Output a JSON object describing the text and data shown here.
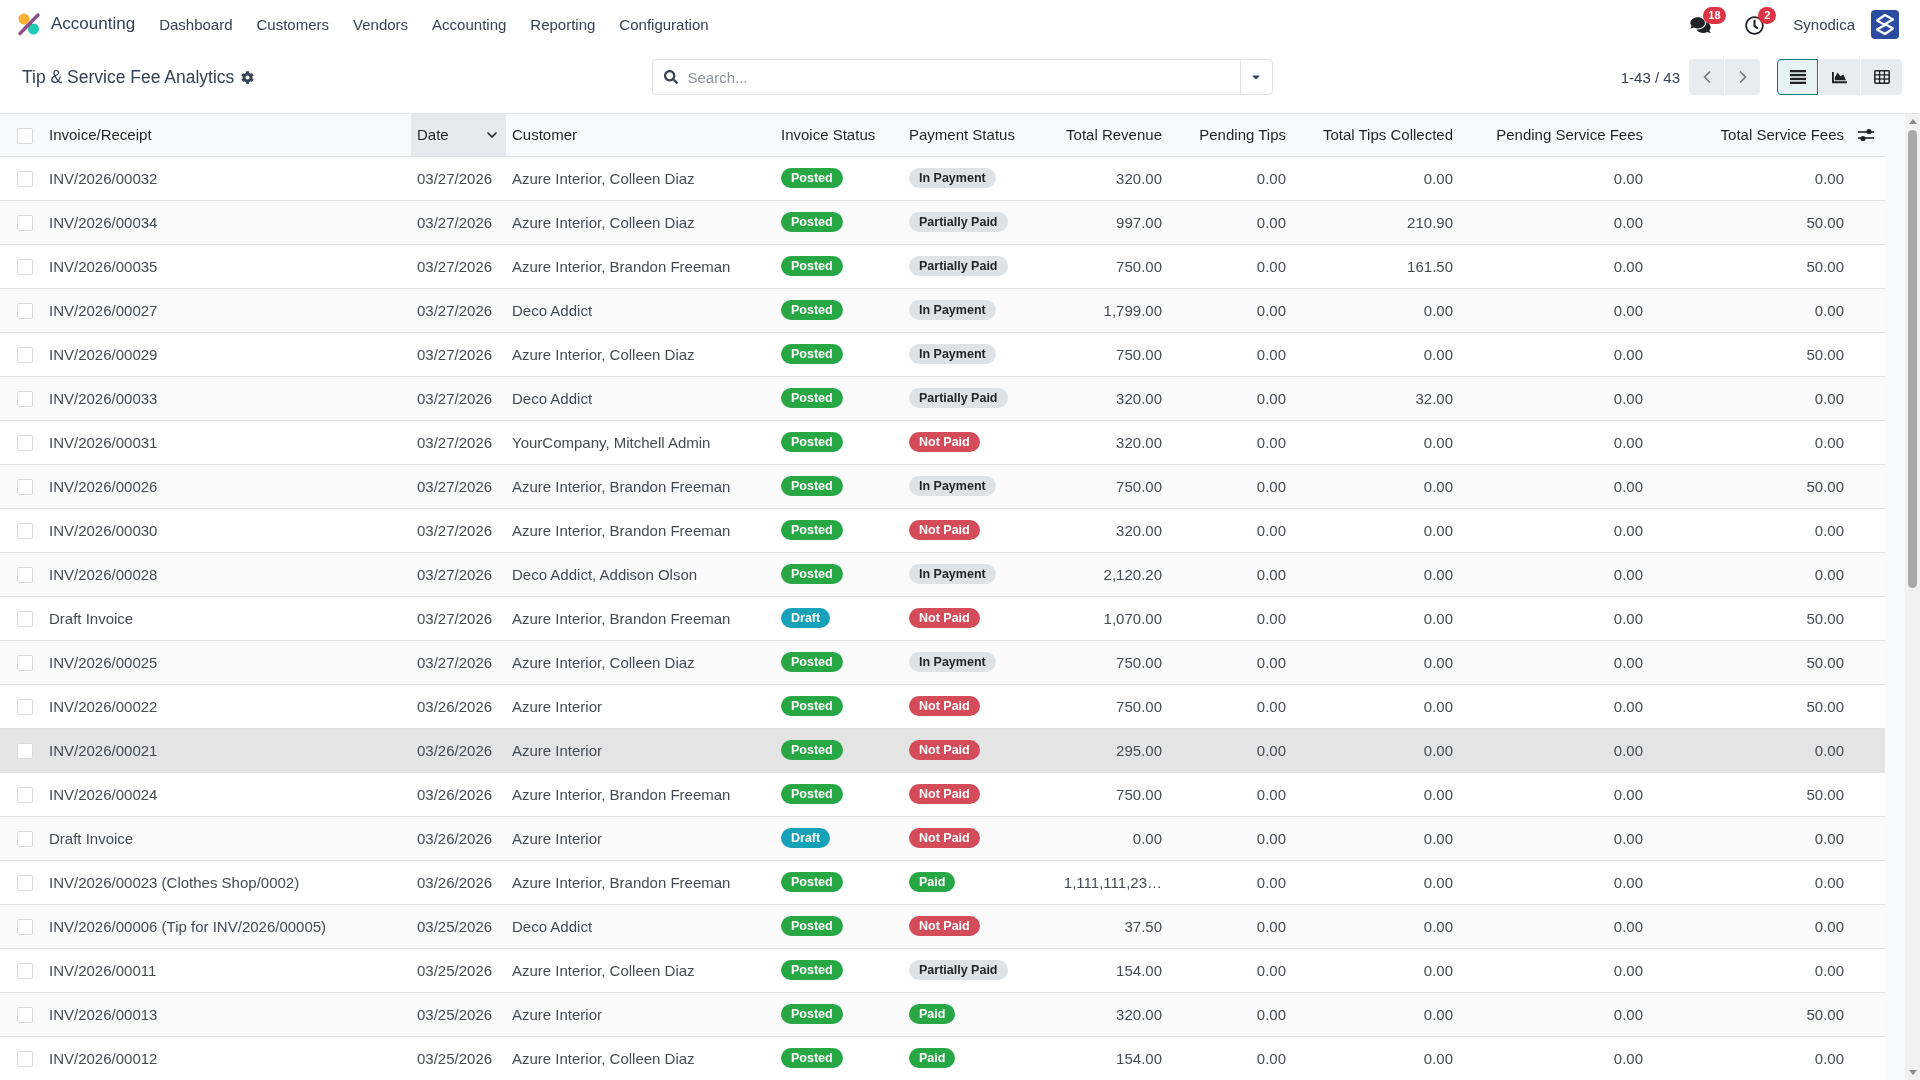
{
  "navbar": {
    "app_name": "Accounting",
    "menu": [
      "Dashboard",
      "Customers",
      "Vendors",
      "Accounting",
      "Reporting",
      "Configuration"
    ],
    "systray": [
      {
        "kind": "messages",
        "count": "18"
      },
      {
        "kind": "activities",
        "count": "2"
      }
    ],
    "company": "Synodica"
  },
  "control_panel": {
    "title": "Tip & Service Fee Analytics",
    "search": {
      "placeholder": "Search..."
    },
    "pager": "1-43 / 43",
    "views": [
      {
        "kind": "list",
        "selected": true
      },
      {
        "kind": "graph",
        "selected": false
      },
      {
        "kind": "pivot",
        "selected": false
      }
    ]
  },
  "table": {
    "all_checked": false,
    "columns": [
      {
        "label": "Invoice/Receipt",
        "kind": "text",
        "sorted": false
      },
      {
        "label": "Date",
        "kind": "text",
        "sorted": true
      },
      {
        "label": "Customer",
        "kind": "text",
        "sorted": false
      },
      {
        "label": "Invoice Status",
        "kind": "badge",
        "sorted": false
      },
      {
        "label": "Payment Status",
        "kind": "badge",
        "sorted": false
      },
      {
        "label": "Total Revenue",
        "kind": "number",
        "sorted": false
      },
      {
        "label": "Pending Tips",
        "kind": "number",
        "sorted": false
      },
      {
        "label": "Total Tips Collected",
        "kind": "number",
        "sorted": false
      },
      {
        "label": "Pending Service Fees",
        "kind": "number",
        "sorted": false
      },
      {
        "label": "Total Service Fees",
        "kind": "number",
        "sorted": false
      }
    ],
    "rows": [
      {
        "checked": false,
        "highlighted": false,
        "cells": [
          "INV/2026/00032",
          "03/27/2026",
          "Azure Interior, Colleen Diaz",
          {
            "label": "Posted",
            "color": "#28a745"
          },
          {
            "label": "In Payment",
            "color": "#dee2e6"
          },
          "320.00",
          "0.00",
          "0.00",
          "0.00",
          "0.00"
        ]
      },
      {
        "checked": false,
        "highlighted": false,
        "cells": [
          "INV/2026/00034",
          "03/27/2026",
          "Azure Interior, Colleen Diaz",
          {
            "label": "Posted",
            "color": "#28a745"
          },
          {
            "label": "Partially Paid",
            "color": "#dee2e6"
          },
          "997.00",
          "0.00",
          "210.90",
          "0.00",
          "50.00"
        ]
      },
      {
        "checked": false,
        "highlighted": false,
        "cells": [
          "INV/2026/00035",
          "03/27/2026",
          "Azure Interior, Brandon Freeman",
          {
            "label": "Posted",
            "color": "#28a745"
          },
          {
            "label": "Partially Paid",
            "color": "#dee2e6"
          },
          "750.00",
          "0.00",
          "161.50",
          "0.00",
          "50.00"
        ]
      },
      {
        "checked": false,
        "highlighted": false,
        "cells": [
          "INV/2026/00027",
          "03/27/2026",
          "Deco Addict",
          {
            "label": "Posted",
            "color": "#28a745"
          },
          {
            "label": "In Payment",
            "color": "#dee2e6"
          },
          "1,799.00",
          "0.00",
          "0.00",
          "0.00",
          "0.00"
        ]
      },
      {
        "checked": false,
        "highlighted": false,
        "cells": [
          "INV/2026/00029",
          "03/27/2026",
          "Azure Interior, Colleen Diaz",
          {
            "label": "Posted",
            "color": "#28a745"
          },
          {
            "label": "In Payment",
            "color": "#dee2e6"
          },
          "750.00",
          "0.00",
          "0.00",
          "0.00",
          "50.00"
        ]
      },
      {
        "checked": false,
        "highlighted": false,
        "cells": [
          "INV/2026/00033",
          "03/27/2026",
          "Deco Addict",
          {
            "label": "Posted",
            "color": "#28a745"
          },
          {
            "label": "Partially Paid",
            "color": "#dee2e6"
          },
          "320.00",
          "0.00",
          "32.00",
          "0.00",
          "0.00"
        ]
      },
      {
        "checked": false,
        "highlighted": false,
        "cells": [
          "INV/2026/00031",
          "03/27/2026",
          "YourCompany, Mitchell Admin",
          {
            "label": "Posted",
            "color": "#28a745"
          },
          {
            "label": "Not Paid",
            "color": "#d44c59"
          },
          "320.00",
          "0.00",
          "0.00",
          "0.00",
          "0.00"
        ]
      },
      {
        "checked": false,
        "highlighted": false,
        "cells": [
          "INV/2026/00026",
          "03/27/2026",
          "Azure Interior, Brandon Freeman",
          {
            "label": "Posted",
            "color": "#28a745"
          },
          {
            "label": "In Payment",
            "color": "#dee2e6"
          },
          "750.00",
          "0.00",
          "0.00",
          "0.00",
          "50.00"
        ]
      },
      {
        "checked": false,
        "highlighted": false,
        "cells": [
          "INV/2026/00030",
          "03/27/2026",
          "Azure Interior, Brandon Freeman",
          {
            "label": "Posted",
            "color": "#28a745"
          },
          {
            "label": "Not Paid",
            "color": "#d44c59"
          },
          "320.00",
          "0.00",
          "0.00",
          "0.00",
          "0.00"
        ]
      },
      {
        "checked": false,
        "highlighted": false,
        "cells": [
          "INV/2026/00028",
          "03/27/2026",
          "Deco Addict, Addison Olson",
          {
            "label": "Posted",
            "color": "#28a745"
          },
          {
            "label": "In Payment",
            "color": "#dee2e6"
          },
          "2,120.20",
          "0.00",
          "0.00",
          "0.00",
          "0.00"
        ]
      },
      {
        "checked": false,
        "highlighted": false,
        "cells": [
          "Draft Invoice",
          "03/27/2026",
          "Azure Interior, Brandon Freeman",
          {
            "label": "Draft",
            "color": "#17a2b8"
          },
          {
            "label": "Not Paid",
            "color": "#d44c59"
          },
          "1,070.00",
          "0.00",
          "0.00",
          "0.00",
          "50.00"
        ]
      },
      {
        "checked": false,
        "highlighted": false,
        "cells": [
          "INV/2026/00025",
          "03/27/2026",
          "Azure Interior, Colleen Diaz",
          {
            "label": "Posted",
            "color": "#28a745"
          },
          {
            "label": "In Payment",
            "color": "#dee2e6"
          },
          "750.00",
          "0.00",
          "0.00",
          "0.00",
          "50.00"
        ]
      },
      {
        "checked": false,
        "highlighted": false,
        "cells": [
          "INV/2026/00022",
          "03/26/2026",
          "Azure Interior",
          {
            "label": "Posted",
            "color": "#28a745"
          },
          {
            "label": "Not Paid",
            "color": "#d44c59"
          },
          "750.00",
          "0.00",
          "0.00",
          "0.00",
          "50.00"
        ]
      },
      {
        "checked": false,
        "highlighted": true,
        "cells": [
          "INV/2026/00021",
          "03/26/2026",
          "Azure Interior",
          {
            "label": "Posted",
            "color": "#28a745"
          },
          {
            "label": "Not Paid",
            "color": "#d44c59"
          },
          "295.00",
          "0.00",
          "0.00",
          "0.00",
          "0.00"
        ]
      },
      {
        "checked": false,
        "highlighted": false,
        "cells": [
          "INV/2026/00024",
          "03/26/2026",
          "Azure Interior, Brandon Freeman",
          {
            "label": "Posted",
            "color": "#28a745"
          },
          {
            "label": "Not Paid",
            "color": "#d44c59"
          },
          "750.00",
          "0.00",
          "0.00",
          "0.00",
          "50.00"
        ]
      },
      {
        "checked": false,
        "highlighted": false,
        "cells": [
          "Draft Invoice",
          "03/26/2026",
          "Azure Interior",
          {
            "label": "Draft",
            "color": "#17a2b8"
          },
          {
            "label": "Not Paid",
            "color": "#d44c59"
          },
          "0.00",
          "0.00",
          "0.00",
          "0.00",
          "0.00"
        ]
      },
      {
        "checked": false,
        "highlighted": false,
        "cells": [
          "INV/2026/00023 (Clothes Shop/0002)",
          "03/26/2026",
          "Azure Interior, Brandon Freeman",
          {
            "label": "Posted",
            "color": "#28a745"
          },
          {
            "label": "Paid",
            "color": "#28a745"
          },
          "1,111,111,23…",
          "0.00",
          "0.00",
          "0.00",
          "0.00"
        ]
      },
      {
        "checked": false,
        "highlighted": false,
        "cells": [
          "INV/2026/00006 (Tip for INV/2026/00005)",
          "03/25/2026",
          "Deco Addict",
          {
            "label": "Posted",
            "color": "#28a745"
          },
          {
            "label": "Not Paid",
            "color": "#d44c59"
          },
          "37.50",
          "0.00",
          "0.00",
          "0.00",
          "0.00"
        ]
      },
      {
        "checked": false,
        "highlighted": false,
        "cells": [
          "INV/2026/00011",
          "03/25/2026",
          "Azure Interior, Colleen Diaz",
          {
            "label": "Posted",
            "color": "#28a745"
          },
          {
            "label": "Partially Paid",
            "color": "#dee2e6"
          },
          "154.00",
          "0.00",
          "0.00",
          "0.00",
          "0.00"
        ]
      },
      {
        "checked": false,
        "highlighted": false,
        "cells": [
          "INV/2026/00013",
          "03/25/2026",
          "Azure Interior",
          {
            "label": "Posted",
            "color": "#28a745"
          },
          {
            "label": "Paid",
            "color": "#28a745"
          },
          "320.00",
          "0.00",
          "0.00",
          "0.00",
          "50.00"
        ]
      },
      {
        "checked": false,
        "highlighted": false,
        "cells": [
          "INV/2026/00012",
          "03/25/2026",
          "Azure Interior, Colleen Diaz",
          {
            "label": "Posted",
            "color": "#28a745"
          },
          {
            "label": "Paid",
            "color": "#28a745"
          },
          "154.00",
          "0.00",
          "0.00",
          "0.00",
          "0.00"
        ]
      }
    ]
  }
}
